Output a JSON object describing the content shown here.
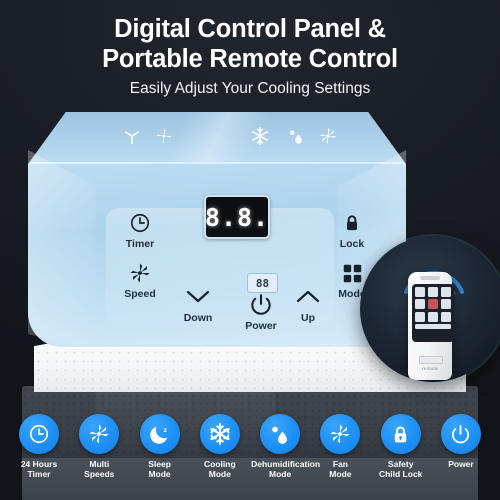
{
  "header": {
    "title_line1": "Digital Control Panel &",
    "title_line2": "Portable Remote Control",
    "subtitle": "Easily Adjust Your Cooling Settings"
  },
  "colors": {
    "background": "#14181f",
    "accent_blue": "#1e90f5",
    "panel_blue": "#bcdcf2",
    "display_bg": "#0d0f12",
    "text_white": "#ffffff",
    "label_dark": "#20303e"
  },
  "control_panel": {
    "display_value": "8.8.",
    "power_display_value": "88",
    "indicator_icons": [
      {
        "name": "fan-blade-icon"
      },
      {
        "name": "fan-speed-icon"
      },
      {
        "name": "snowflake-icon"
      },
      {
        "name": "water-drop-icon"
      },
      {
        "name": "fan-mode-icon"
      }
    ],
    "buttons": [
      {
        "label": "Timer",
        "icon": "clock-icon"
      },
      {
        "label": "Speed",
        "icon": "fan-speed-icon"
      },
      {
        "label": "Lock",
        "icon": "padlock-icon"
      },
      {
        "label": "Mode",
        "icon": "grid-squares-icon"
      },
      {
        "label": "Down",
        "icon": "chevron-down-icon"
      },
      {
        "label": "Power",
        "icon": "power-icon"
      },
      {
        "label": "Up",
        "icon": "chevron-up-icon"
      }
    ]
  },
  "remote": {
    "brand_text": "remote"
  },
  "features": [
    {
      "label_line1": "24 Hours",
      "label_line2": "Timer",
      "icon": "clock-icon"
    },
    {
      "label_line1": "Multi",
      "label_line2": "Speeds",
      "icon": "fan-speed-icon"
    },
    {
      "label_line1": "Sleep",
      "label_line2": "Mode",
      "icon": "moon-sleep-icon"
    },
    {
      "label_line1": "Cooling",
      "label_line2": "Mode",
      "icon": "snowflake-icon"
    },
    {
      "label_line1": "Dehumidification",
      "label_line2": "Mode",
      "icon": "water-drop-icon"
    },
    {
      "label_line1": "Fan",
      "label_line2": "Mode",
      "icon": "fan-mode-icon"
    },
    {
      "label_line1": "Safety",
      "label_line2": "Child Lock",
      "icon": "padlock-icon"
    },
    {
      "label_line1": "Power",
      "label_line2": "",
      "icon": "power-icon"
    }
  ]
}
